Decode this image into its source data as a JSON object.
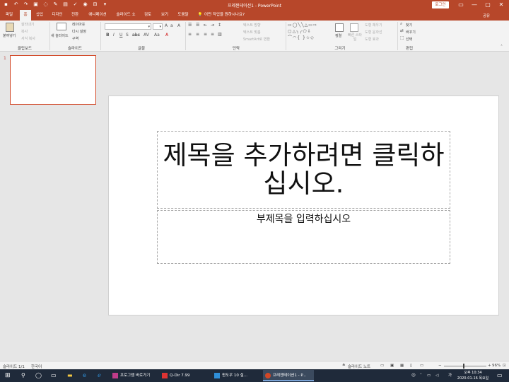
{
  "window": {
    "title": "프레젠테이션1 - PowerPoint",
    "login_label": "로그인",
    "share_label": "공유"
  },
  "tabs": [
    {
      "label": "파일"
    },
    {
      "label": "홈"
    },
    {
      "label": "삽입"
    },
    {
      "label": "디자인"
    },
    {
      "label": "전환"
    },
    {
      "label": "애니메이션"
    },
    {
      "label": "슬라이드 쇼"
    },
    {
      "label": "검토"
    },
    {
      "label": "보기"
    },
    {
      "label": "도움말"
    }
  ],
  "tell_me": "어떤 작업을 원하시나요?",
  "ribbon": {
    "clipboard": {
      "paste": "붙여넣기",
      "cut": "잘라내기",
      "copy": "복사",
      "format_painter": "서식 복사",
      "label": "클립보드"
    },
    "slides": {
      "new_slide": "새 슬라이드",
      "layout": "레이아웃",
      "reset": "다시 설정",
      "section": "구역",
      "label": "슬라이드"
    },
    "font": {
      "label": "글꼴"
    },
    "paragraph": {
      "text_direction": "텍스트 방향",
      "align_text": "텍스트 맞춤",
      "smartart": "SmartArt로 변환",
      "label": "단락"
    },
    "drawing": {
      "arrange": "정렬",
      "quick_styles": "빠른 스타일",
      "shape_fill": "도형 채우기",
      "shape_outline": "도형 윤곽선",
      "shape_effects": "도형 효과",
      "label": "그리기"
    },
    "editing": {
      "find": "찾기",
      "replace": "바꾸기",
      "select": "선택",
      "label": "편집"
    }
  },
  "thumbnail": {
    "number": "1"
  },
  "slide": {
    "title_placeholder": "제목을 추가하려면 클릭하십시오.",
    "subtitle_placeholder": "부제목을 입력하십시오"
  },
  "statusbar": {
    "slide_count": "슬라이드 1/1",
    "language": "한국어",
    "notes": "슬라이드 노트",
    "zoom": "96%"
  },
  "taskbar": {
    "items": [
      {
        "label": "프로그램 바로가기"
      },
      {
        "label": "Q-Dir 7.99"
      },
      {
        "label": "윈도우 10 설..."
      },
      {
        "label": "프레젠테이션1 - P..."
      }
    ],
    "ime": "가",
    "time": "오후 10:34",
    "date": "2020-01-16 목요일"
  },
  "colors": {
    "accent": "#b7472a",
    "thumb_border": "#d24726",
    "taskbar": "#1f2a3a"
  }
}
